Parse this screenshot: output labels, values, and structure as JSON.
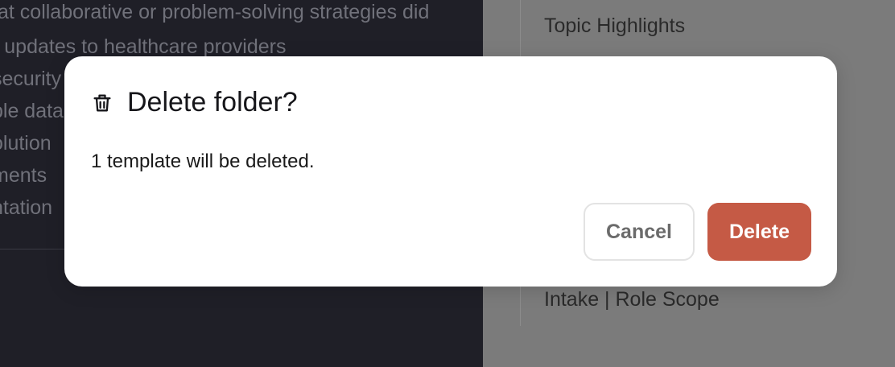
{
  "background": {
    "left_lines": [
      "at collaborative or problem-solving strategies did",
      "- updates to healthcare providers",
      "security",
      "ble data",
      "olution",
      "ments",
      "ntation"
    ],
    "right_texts": {
      "topic_highlights": "Topic Highlights",
      "intake_role_scope": "Intake | Role Scope"
    }
  },
  "dialog": {
    "icon": "trash-icon",
    "title": "Delete folder?",
    "message": "1 template will be deleted.",
    "cancel_label": "Cancel",
    "delete_label": "Delete"
  },
  "colors": {
    "danger": "#c55a45",
    "left_panel": "#1f1f27",
    "right_panel": "#7b7b7b"
  }
}
